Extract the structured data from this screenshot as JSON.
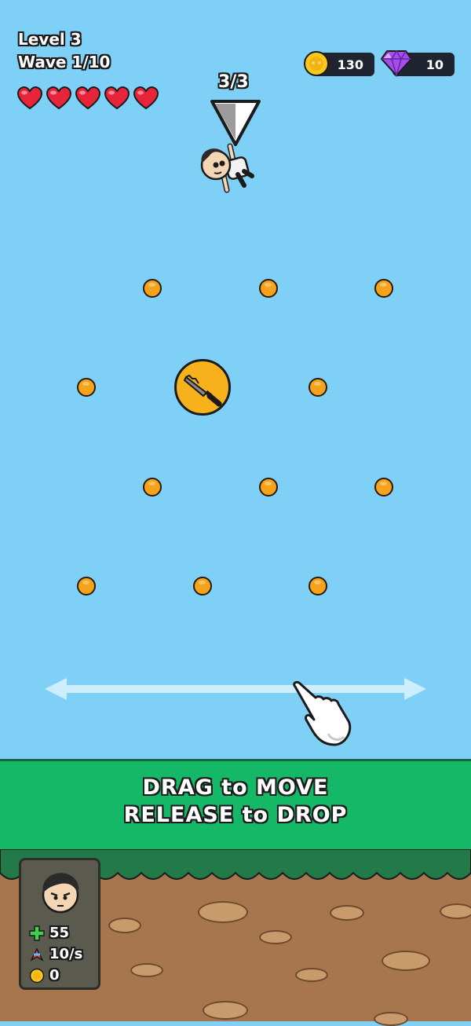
{
  "hud": {
    "level": "Level 3",
    "wave": "Wave 1/10",
    "hearts": 5,
    "coins": "130",
    "gems": "10",
    "drop_count": "3/3"
  },
  "board": {
    "weapon_icon": "knife-icon"
  },
  "tutorial": {
    "line1": "DRAG to MOVE",
    "line2": "RELEASE to DROP"
  },
  "player_stats": {
    "health": "55",
    "rate": "10/s",
    "coins": "0"
  },
  "colors": {
    "sky": "#7fd0f7",
    "peg": "#f7a21b",
    "banner": "#15b866",
    "ground": "#a8764e"
  }
}
